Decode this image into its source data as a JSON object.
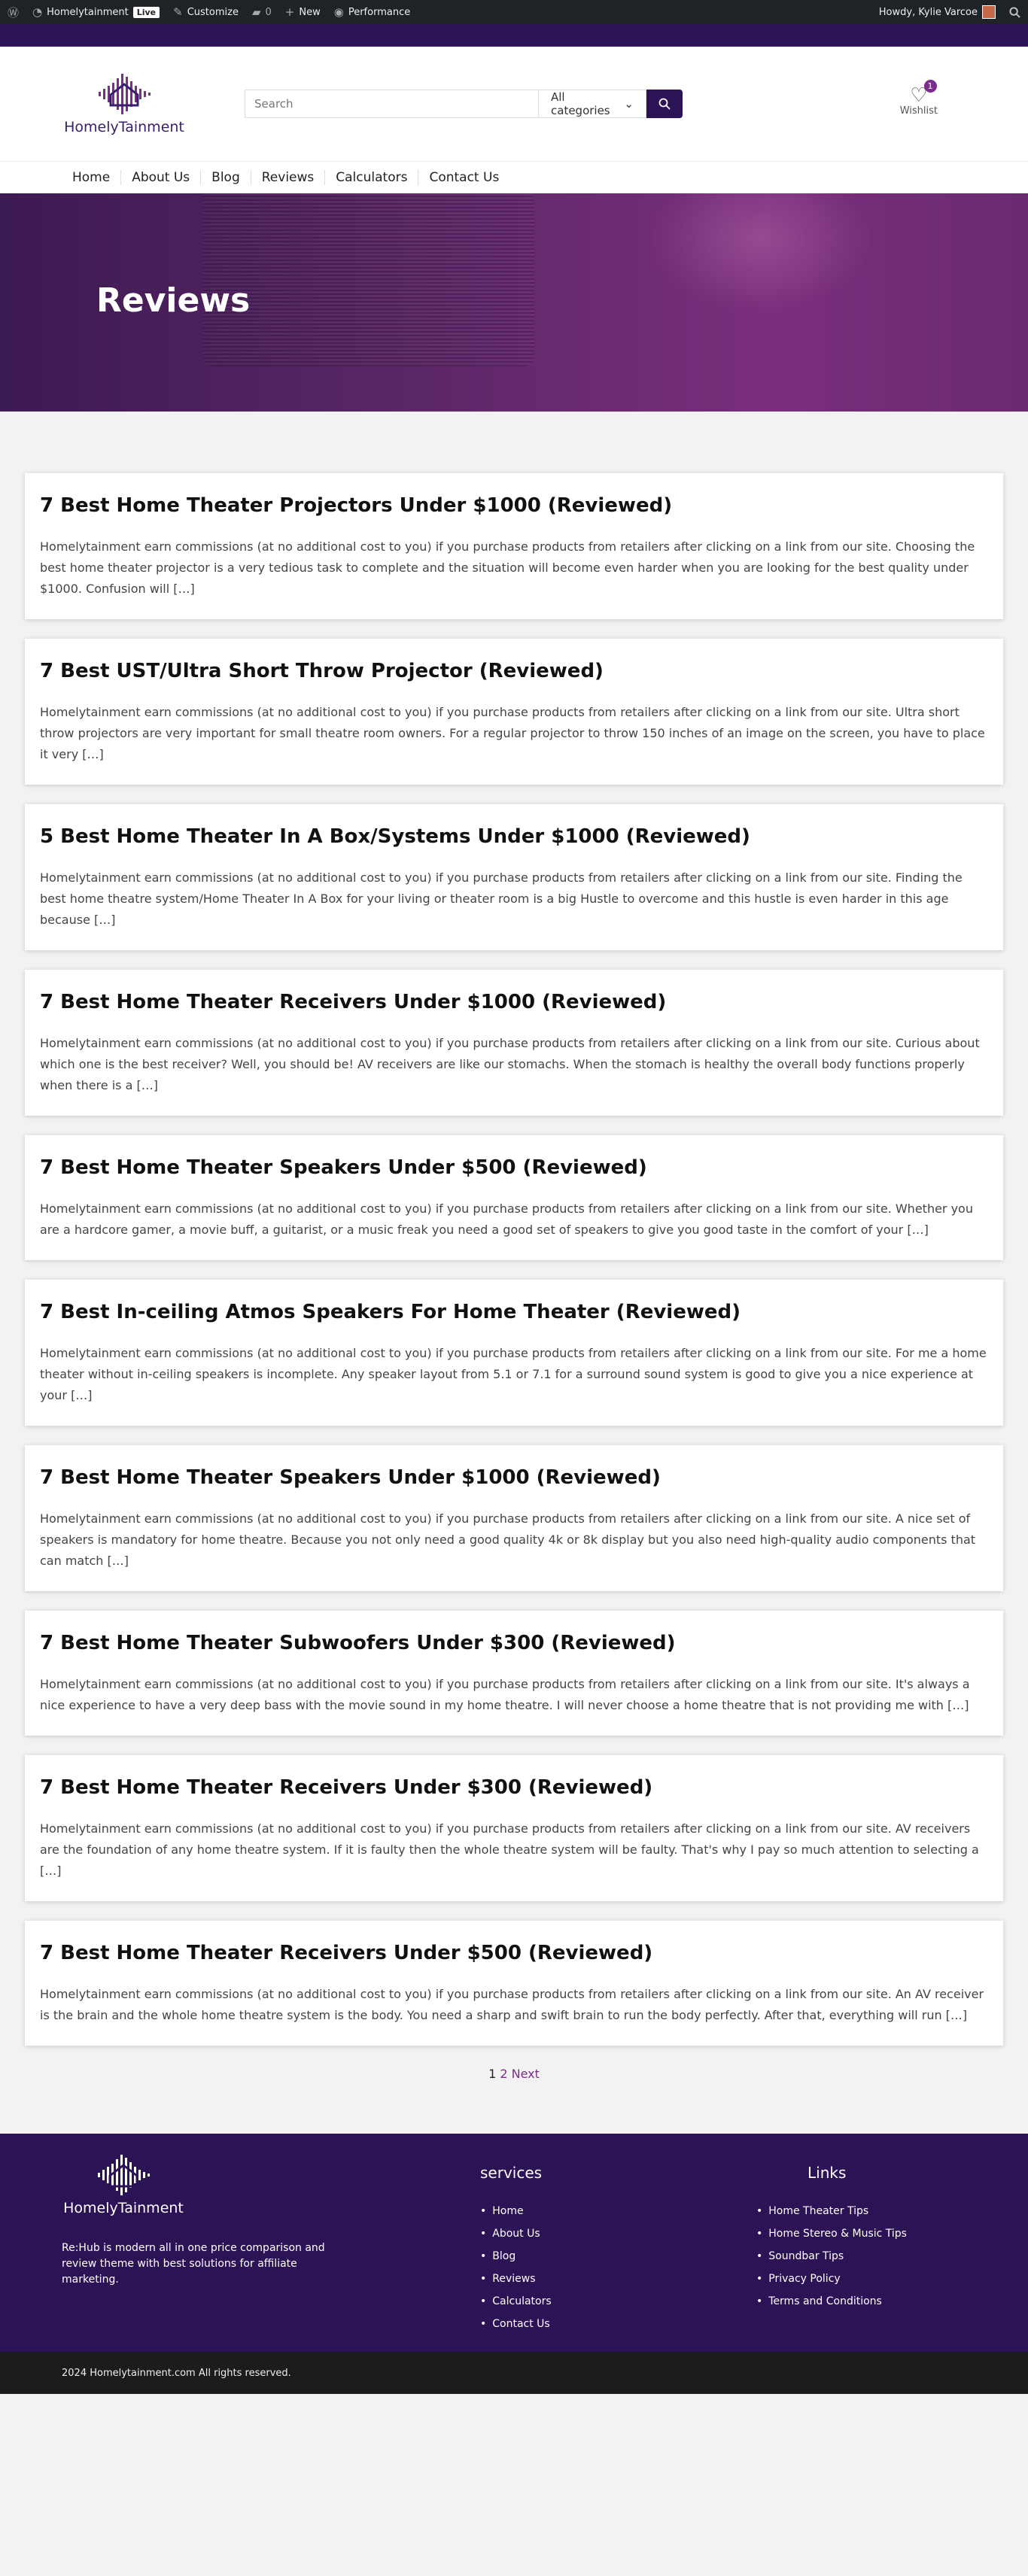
{
  "adminbar": {
    "site_name": "Homelytainment",
    "live_badge": "Live",
    "customize": "Customize",
    "comments_count": "0",
    "new": "New",
    "performance": "Performance",
    "howdy": "Howdy, Kylie Varcoe"
  },
  "header": {
    "logo_text": "HomelyTainment",
    "search_placeholder": "Search",
    "category_select": "All categories",
    "wishlist_label": "Wishlist",
    "wishlist_count": "1"
  },
  "nav": {
    "items": [
      "Home",
      "About Us",
      "Blog",
      "Reviews",
      "Calculators",
      "Contact Us"
    ]
  },
  "hero": {
    "title": "Reviews"
  },
  "posts": [
    {
      "title": "7 Best Home Theater Projectors Under $1000 (Reviewed)",
      "excerpt": "Homelytainment earn commissions (at no additional cost to you) if you purchase products from retailers after clicking on a link from our site. Choosing the best home theater projector is a very tedious task to complete and the situation will become even harder when you are looking for the best quality under $1000. Confusion will […]"
    },
    {
      "title": "7 Best UST/Ultra Short Throw Projector (Reviewed)",
      "excerpt": "Homelytainment earn commissions (at no additional cost to you) if you purchase products from retailers after clicking on a link from our site. Ultra short throw projectors are very important for small theatre room owners. For a regular projector to throw 150 inches of an image on the screen, you have to place it very […]"
    },
    {
      "title": "5 Best Home Theater In A Box/Systems Under $1000 (Reviewed)",
      "excerpt": "Homelytainment earn commissions (at no additional cost to you) if you purchase products from retailers after clicking on a link from our site. Finding the best home theatre system/Home Theater In A Box for your living or theater room is a big Hustle to overcome and this hustle is even harder in this age because […]"
    },
    {
      "title": "7 Best Home Theater Receivers Under $1000 (Reviewed)",
      "excerpt": "Homelytainment earn commissions (at no additional cost to you) if you purchase products from retailers after clicking on a link from our site. Curious about which one is the best receiver? Well, you should be! AV receivers are like our stomachs. When the stomach is healthy the overall body functions properly when there is a […]"
    },
    {
      "title": "7 Best Home Theater Speakers Under $500 (Reviewed)",
      "excerpt": "Homelytainment earn commissions (at no additional cost to you) if you purchase products from retailers after clicking on a link from our site. Whether you are a hardcore gamer, a movie buff, a guitarist, or a music freak you need a good set of speakers to give you good taste in the comfort of your […]"
    },
    {
      "title": "7 Best In-ceiling Atmos Speakers For Home Theater (Reviewed)",
      "excerpt": "Homelytainment earn commissions (at no additional cost to you) if you purchase products from retailers after clicking on a link from our site. For me a home theater without in-ceiling speakers is incomplete. Any speaker layout from 5.1 or 7.1 for a surround sound system is good to give you a nice experience at your […]"
    },
    {
      "title": "7 Best Home Theater Speakers Under $1000 (Reviewed)",
      "excerpt": "Homelytainment earn commissions (at no additional cost to you) if you purchase products from retailers after clicking on a link from our site. A nice set of speakers is mandatory for home theatre. Because you not only need a good quality 4k or 8k display but you also need high-quality audio components that can match […]"
    },
    {
      "title": "7 Best Home Theater Subwoofers Under $300 (Reviewed)",
      "excerpt": "Homelytainment earn commissions (at no additional cost to you) if you purchase products from retailers after clicking on a link from our site. It's always a nice experience to have a very deep bass with the movie sound in my home theatre. I will never choose a home theatre that is not providing me with […]"
    },
    {
      "title": "7 Best Home Theater Receivers Under $300 (Reviewed)",
      "excerpt": "Homelytainment earn commissions (at no additional cost to you) if you purchase products from retailers after clicking on a link from our site. AV receivers are the foundation of any home theatre system. If it is faulty then the whole theatre system will be faulty. That's why I pay so much attention to selecting a […]"
    },
    {
      "title": "7 Best Home Theater Receivers Under $500 (Reviewed)",
      "excerpt": "Homelytainment earn commissions (at no additional cost to you) if you purchase products from retailers after clicking on a link from our site. An AV receiver is the brain and the whole home theatre system is the body. You need a sharp and swift brain to run the body perfectly. After that, everything will run […]"
    }
  ],
  "pagination": {
    "current": "1",
    "page2": "2",
    "next": "Next"
  },
  "footer": {
    "logo_text": "HomelyTainment",
    "description": "Re:Hub is modern all in one price comparison and review theme with best solutions for affiliate marketing.",
    "services_title": "services",
    "services": [
      "Home",
      "About Us",
      "Blog",
      "Reviews",
      "Calculators",
      "Contact Us"
    ],
    "links_title": "Links",
    "links": [
      "Home Theater Tips",
      "Home Stereo & Music Tips",
      "Soundbar Tips",
      "Privacy Policy",
      "Terms and Conditions"
    ],
    "copyright": "2024 Homelytainment.com All rights reserved."
  },
  "colors": {
    "brand_purple": "#2b1356",
    "accent": "#7b2c8c",
    "admin_bar": "#1d2327"
  }
}
